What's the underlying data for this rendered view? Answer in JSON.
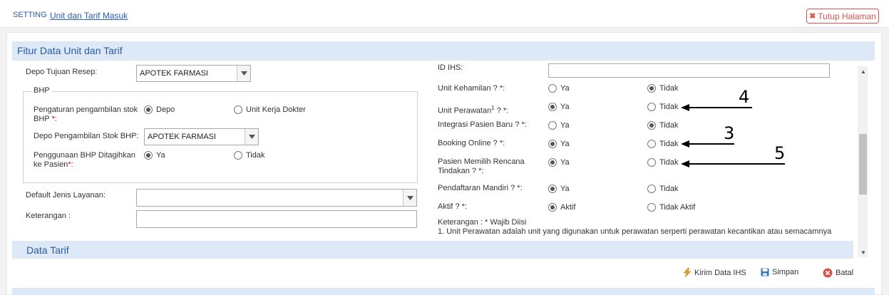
{
  "header": {
    "section": "SETTING",
    "breadcrumb": "Unit dan Tarif Masuk",
    "close_label": "Tutup Halaman"
  },
  "panel": {
    "title": "Fitur Data Unit dan Tarif"
  },
  "left": {
    "depo_tujuan_resep_label": "Depo Tujuan Resep:",
    "depo_tujuan_resep_value": "APOTEK FARMASI",
    "bhp_legend": "BHP",
    "pengaturan_label": "Pengaturan pengambilan stok BHP",
    "required_mark": "*:",
    "pengaturan_opt1": "Depo",
    "pengaturan_opt2": "Unit Kerja Dokter",
    "depo_pengambilan_label": "Depo Pengambilan Stok BHP:",
    "depo_pengambilan_value": "APOTEK FARMASI",
    "penggunaan_label": "Penggunaan BHP Ditagihkan ke Pasien",
    "penggunaan_opt1": "Ya",
    "penggunaan_opt2": "Tidak",
    "default_jenis_label": "Default Jenis Layanan:",
    "default_jenis_value": "",
    "keterangan_label": "Keterangan :",
    "keterangan_value": ""
  },
  "right": {
    "id_ihs_label": "ID IHS:",
    "id_ihs_value": "",
    "rows": [
      {
        "label": "Unit Kehamilan ? *:",
        "opt1": "Ya",
        "opt2": "Tidak",
        "selected": 2
      },
      {
        "label": "Unit Perawatan",
        "sup": "1",
        "label_tail": " ? *:",
        "opt1": "Ya",
        "opt2": "Tidak",
        "selected": 1
      },
      {
        "label": "Integrasi Pasien Baru ? *:",
        "opt1": "Ya",
        "opt2": "Tidak",
        "selected": 2
      },
      {
        "label": "Booking Online ? *:",
        "opt1": "Ya",
        "opt2": "Tidak",
        "selected": 1
      },
      {
        "label": "Pasien Memilih Rencana Tindakan ? *:",
        "opt1": "Ya",
        "opt2": "Tidak",
        "selected": 1
      },
      {
        "label": "Pendaftaran Mandiri ? *:",
        "opt1": "Ya",
        "opt2": "Tidak",
        "selected": 1
      },
      {
        "label": "Aktif ? *:",
        "opt1": "Aktif",
        "opt2": "Tidak Aktif",
        "selected": 1
      }
    ],
    "note_title": "Keterangan : * Wajib Diisi",
    "note_1": "1. Unit Perawatan adalah unit yang digunakan untuk perawatan serperti perawatan kecantikan atau semacamnya"
  },
  "data_tarif": {
    "title": "Data Tarif"
  },
  "actions": {
    "kirim": "Kirim Data IHS",
    "simpan": "Simpan",
    "batal": "Batal"
  },
  "annotations": [
    "4",
    "3",
    "5"
  ],
  "colors": {
    "accent": "#2b5aa3",
    "header_bg": "#dde9f7",
    "danger": "#d9534f",
    "required": "#e00000"
  }
}
